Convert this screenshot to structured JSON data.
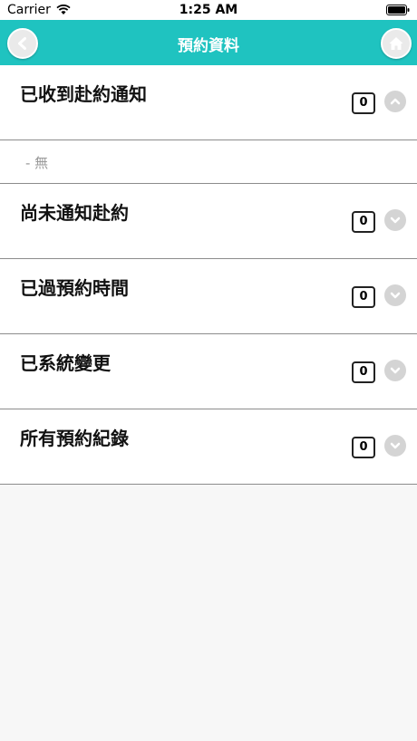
{
  "status": {
    "carrier": "Carrier",
    "time": "1:25 AM"
  },
  "nav": {
    "title": "預約資料",
    "back_icon": "back-arrow-icon",
    "home_icon": "home-icon",
    "accent_color": "#1fc3c0"
  },
  "sections": [
    {
      "label": "已收到赴約通知",
      "count": "0",
      "expanded": true
    },
    {
      "label": "尚未通知赴約",
      "count": "0",
      "expanded": false
    },
    {
      "label": "已過預約時間",
      "count": "0",
      "expanded": false
    },
    {
      "label": "已系統變更",
      "count": "0",
      "expanded": false
    },
    {
      "label": "所有預約紀錄",
      "count": "0",
      "expanded": false
    }
  ],
  "expanded_section": {
    "empty_text": "- 無"
  }
}
